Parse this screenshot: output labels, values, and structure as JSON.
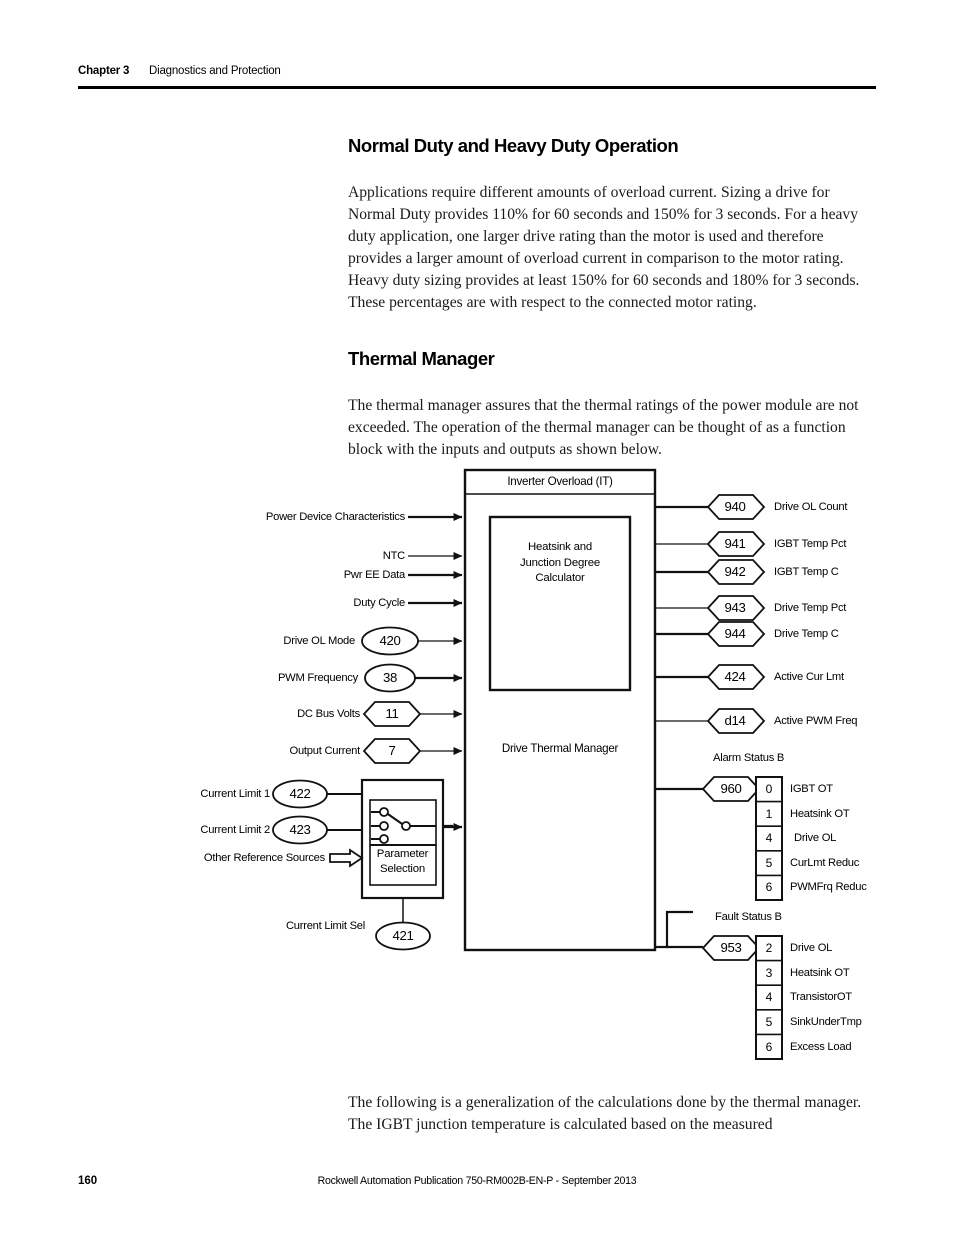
{
  "header": {
    "chapter": "Chapter 3",
    "topic": "Diagnostics and Protection"
  },
  "footer": {
    "page_number": "160",
    "publication": "Rockwell Automation Publication 750-RM002B-EN-P - September 2013"
  },
  "sections": [
    {
      "heading": "Normal Duty and Heavy Duty Operation",
      "body": "Applications require different amounts of overload current. Sizing a drive for Normal Duty provides 110% for 60 seconds and 150% for 3 seconds. For a heavy duty application, one larger drive rating than the motor is used and therefore provides a larger amount of overload current in comparison to the motor rating. Heavy duty sizing provides at least 150% for 60 seconds and 180% for 3 seconds. These percentages are with respect to the connected motor rating."
    },
    {
      "heading": "Thermal Manager",
      "body": "The thermal manager assures that the thermal ratings of the power module are not exceeded. The operation of the thermal manager can be thought of as a function block with the inputs and outputs as shown below."
    }
  ],
  "closing_paragraph": "The following is a generalization of the calculations done by the thermal manager. The IGBT junction temperature is calculated based on the measured",
  "diagram": {
    "title_bar": "Inverter Overload (IT)",
    "inner_block": "Heatsink and\nJunction Degree\nCalculator",
    "inner_block_lines": [
      "Heatsink and",
      "Junction Degree",
      "Calculator"
    ],
    "outer_block_label": "Drive Thermal Manager",
    "selector_block_lines": [
      "Parameter",
      "Selection"
    ],
    "inputs": [
      {
        "label": "Power Device Characteristics",
        "param": null,
        "shape": "none"
      },
      {
        "label": "NTC",
        "param": null,
        "shape": "none"
      },
      {
        "label": "Pwr EE Data",
        "param": null,
        "shape": "none"
      },
      {
        "label": "Duty Cycle",
        "param": null,
        "shape": "none"
      },
      {
        "label": "Drive OL Mode",
        "param": "420",
        "shape": "ellipse"
      },
      {
        "label": "PWM Frequency",
        "param": "38",
        "shape": "ellipse"
      },
      {
        "label": "DC Bus Volts",
        "param": "11",
        "shape": "hexagon"
      },
      {
        "label": "Output Current",
        "param": "7",
        "shape": "hexagon"
      }
    ],
    "selector_inputs": [
      {
        "label": "Current Limit 1",
        "param": "422",
        "shape": "ellipse"
      },
      {
        "label": "Current Limit 2",
        "param": "423",
        "shape": "ellipse"
      },
      {
        "label": "Other Reference Sources",
        "param": null,
        "shape": "block-arrow"
      }
    ],
    "selector_control": {
      "label": "Current Limit Sel",
      "param": "421",
      "shape": "ellipse"
    },
    "outputs": [
      {
        "param": "940",
        "label": "Drive OL Count"
      },
      {
        "param": "941",
        "label": "IGBT Temp Pct"
      },
      {
        "param": "942",
        "label": "IGBT Temp C"
      },
      {
        "param": "943",
        "label": "Drive Temp Pct"
      },
      {
        "param": "944",
        "label": "Drive Temp C"
      },
      {
        "param": "424",
        "label": "Active Cur Lmt"
      },
      {
        "param": "d14",
        "label": "Active PWM Freq"
      }
    ],
    "status_groups": [
      {
        "title": "Alarm Status B",
        "param": "960",
        "bits": [
          {
            "bit": "0",
            "label": "IGBT OT"
          },
          {
            "bit": "1",
            "label": "Heatsink OT"
          },
          {
            "bit": "4",
            "label": "Drive OL"
          },
          {
            "bit": "5",
            "label": "CurLmt Reduc"
          },
          {
            "bit": "6",
            "label": "PWMFrq Reduc"
          }
        ]
      },
      {
        "title": "Fault Status B",
        "param": "953",
        "bits": [
          {
            "bit": "2",
            "label": "Drive OL"
          },
          {
            "bit": "3",
            "label": "Heatsink OT"
          },
          {
            "bit": "4",
            "label": "TransistorOT"
          },
          {
            "bit": "5",
            "label": "SinkUnderTmp"
          },
          {
            "bit": "6",
            "label": "Excess Load"
          }
        ]
      }
    ]
  }
}
